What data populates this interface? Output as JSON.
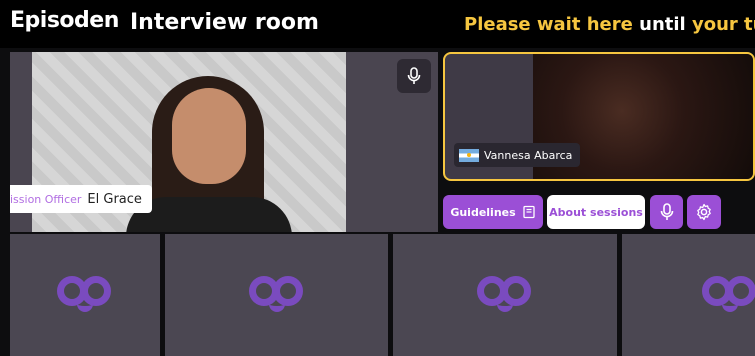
{
  "header": {
    "brand": "Episoden",
    "room_title": "Interview room",
    "notice_part1": "Please wait here",
    "notice_part2": "until",
    "notice_part3": "your turn"
  },
  "main_participant": {
    "role": "ission Officer",
    "name": "El Grace",
    "mic_icon": "microphone-icon"
  },
  "side_participant": {
    "name": "Vannesa Abarca",
    "flag": "argentina-flag-icon"
  },
  "controls": {
    "guidelines_label": "Guidelines",
    "guidelines_icon": "book-icon",
    "about_label": "About sessions",
    "mic_icon": "microphone-icon",
    "settings_icon": "gear-icon"
  },
  "colors": {
    "accent": "#9b4fd6",
    "highlight": "#f6c640",
    "tile_bg": "#4b4752",
    "logo": "#7a4bbf"
  },
  "empty_tiles": [
    {
      "logo": "episoden-logo"
    },
    {
      "logo": "episoden-logo"
    },
    {
      "logo": "episoden-logo"
    },
    {
      "logo": "episoden-logo"
    }
  ]
}
